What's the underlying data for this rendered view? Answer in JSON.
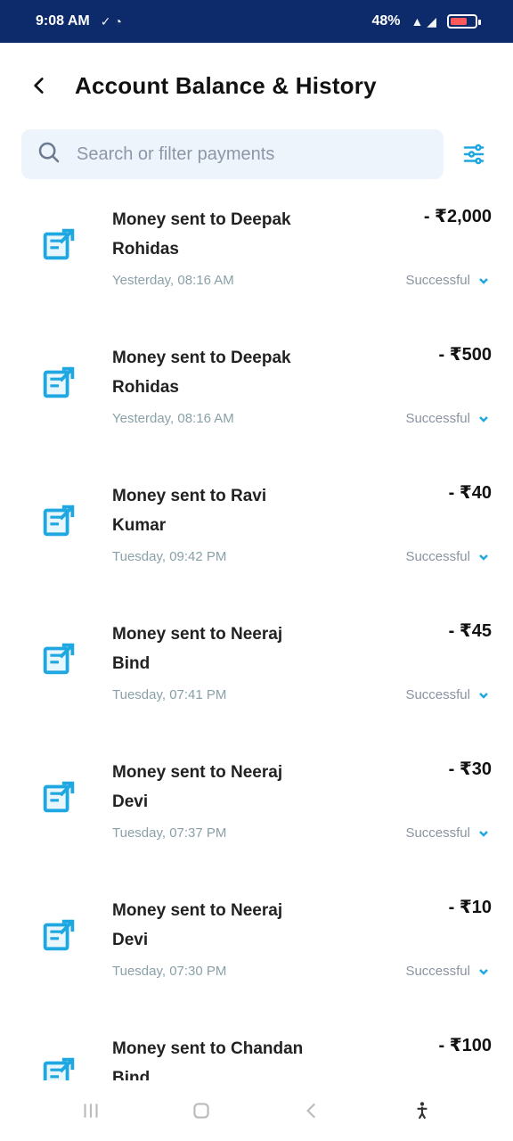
{
  "status_bar": {
    "time": "9:08 AM",
    "battery": "48%"
  },
  "header": {
    "title": "Account Balance & History",
    "back_icon": "back-arrow-icon"
  },
  "search": {
    "placeholder": "Search or filter payments",
    "icon": "search-icon",
    "filter_icon": "filter-icon"
  },
  "transactions": [
    {
      "title_line1": "Money sent to Deepak",
      "title_line2": "Rohidas",
      "amount": "- ₹2,000",
      "date": "Yesterday, 08:16 AM",
      "status": "Successful"
    },
    {
      "title_line1": "Money sent to Deepak",
      "title_line2": "Rohidas",
      "amount": "- ₹500",
      "date": "Yesterday, 08:16 AM",
      "status": "Successful"
    },
    {
      "title_line1": "Money sent to Ravi",
      "title_line2": "Kumar",
      "amount": "- ₹40",
      "date": "Tuesday, 09:42 PM",
      "status": "Successful"
    },
    {
      "title_line1": "Money sent to Neeraj",
      "title_line2": "Bind",
      "amount": "- ₹45",
      "date": "Tuesday, 07:41 PM",
      "status": "Successful"
    },
    {
      "title_line1": "Money sent to Neeraj",
      "title_line2": "Devi",
      "amount": "- ₹30",
      "date": "Tuesday, 07:37 PM",
      "status": "Successful"
    },
    {
      "title_line1": "Money sent to Neeraj",
      "title_line2": "Devi",
      "amount": "- ₹10",
      "date": "Tuesday, 07:30 PM",
      "status": "Successful"
    },
    {
      "title_line1": "Money sent to Chandan",
      "title_line2": "Bind",
      "amount": "- ₹100",
      "date": "",
      "status": ""
    }
  ],
  "colors": {
    "status_bar": "#0d2a6b",
    "accent": "#1ea7e1",
    "search_bg": "#eef4fb"
  },
  "nav": {
    "menu_icon": "menu-icon",
    "home_icon": "home-icon",
    "back_icon": "nav-back-icon",
    "accessibility_icon": "accessibility-icon"
  }
}
